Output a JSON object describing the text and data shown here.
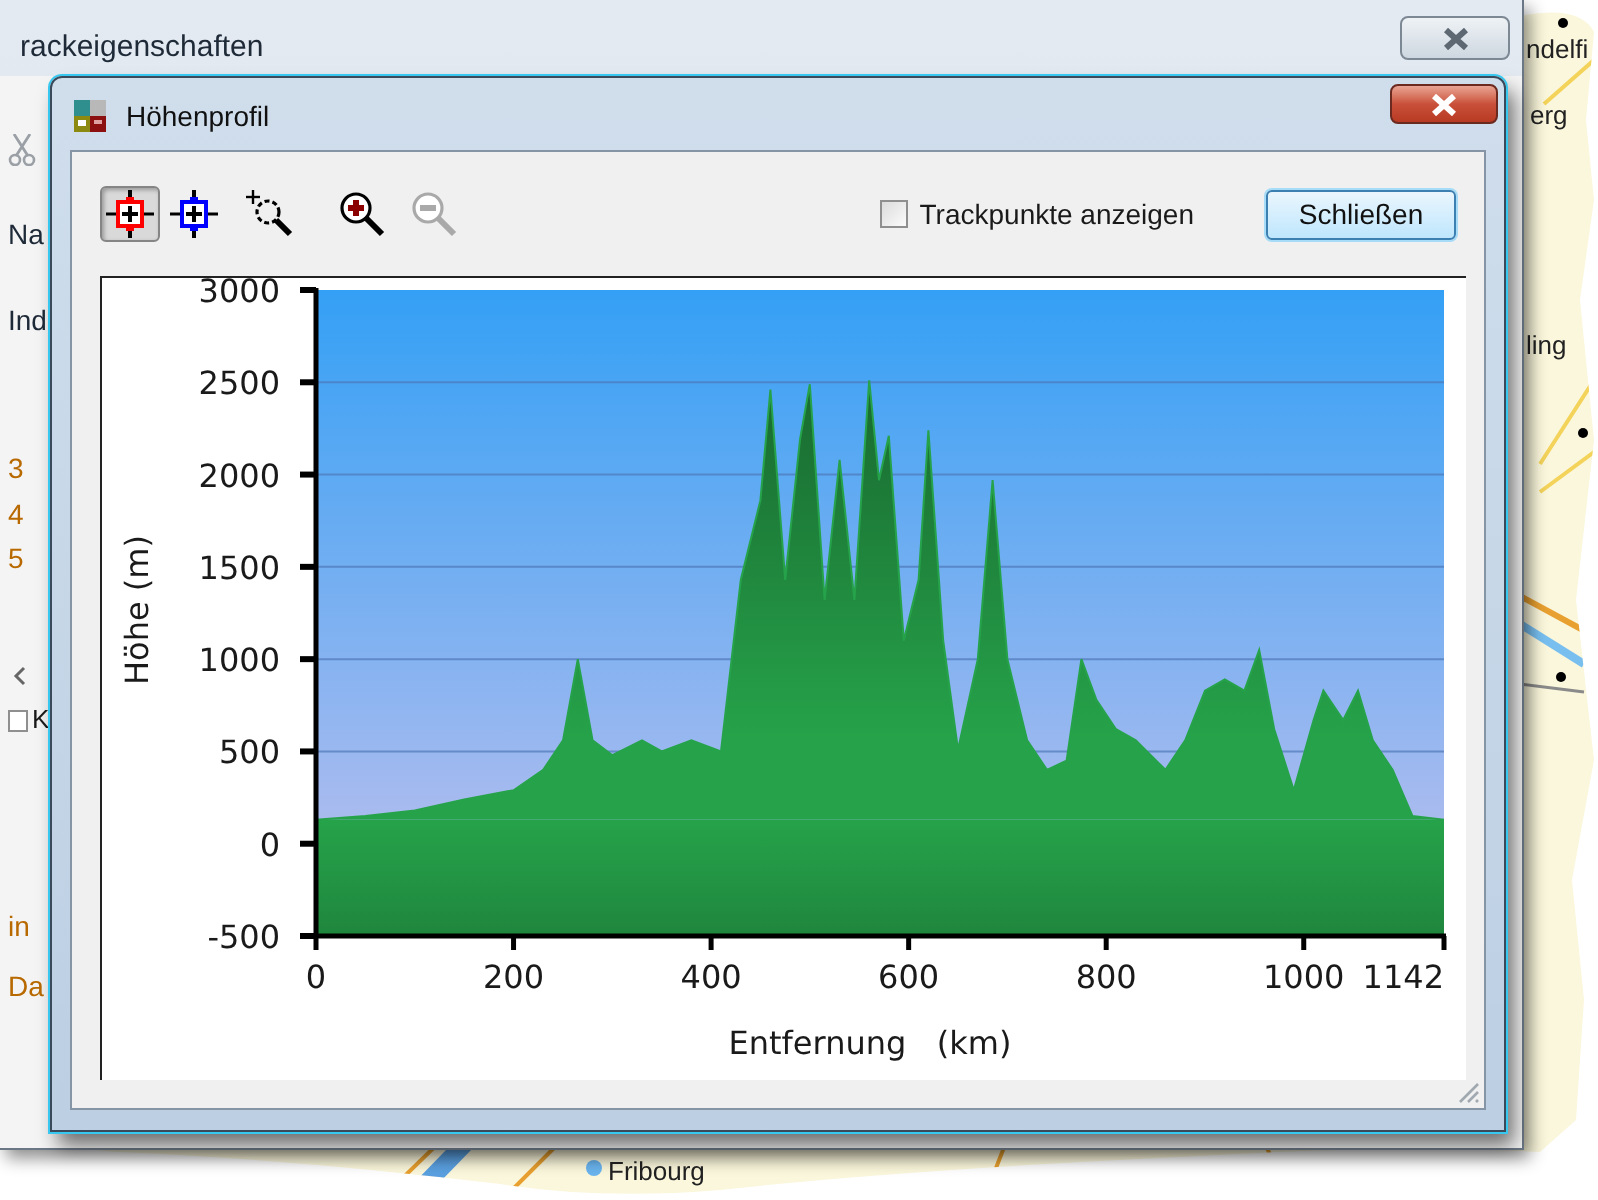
{
  "desktop": {
    "map_labels": [
      "ndelfi",
      "erg",
      "ling",
      "Fribourg"
    ]
  },
  "back_window": {
    "title": "rackeigenschaften",
    "items": [
      {
        "kind": "text",
        "text": "Na"
      },
      {
        "kind": "text",
        "text": "Ind"
      },
      {
        "kind": "text",
        "text": "3"
      },
      {
        "kind": "text",
        "text": "4"
      },
      {
        "kind": "text",
        "text": "5"
      },
      {
        "kind": "checkbox",
        "text": "K",
        "checked": false
      },
      {
        "kind": "text",
        "text": "in"
      },
      {
        "kind": "text",
        "text": "Da"
      }
    ]
  },
  "window": {
    "title": "Höhenprofil",
    "tools": [
      {
        "selected": true,
        "disabled": false
      },
      {
        "selected": false,
        "disabled": false
      },
      {
        "selected": false,
        "disabled": false
      },
      {
        "selected": false,
        "disabled": false
      },
      {
        "selected": false,
        "disabled": true
      }
    ],
    "checkbox": {
      "label": "Trackpunkte anzeigen",
      "checked": false
    },
    "button": "Schließen",
    "chart_data": {
      "type": "area",
      "xlabel": "Entfernung   (km)",
      "ylabel": "Höhe (m)",
      "x": [
        0,
        50,
        100,
        150,
        200,
        230,
        250,
        265,
        280,
        300,
        330,
        350,
        380,
        410,
        430,
        450,
        460,
        475,
        490,
        500,
        515,
        530,
        545,
        560,
        570,
        580,
        595,
        610,
        620,
        635,
        650,
        670,
        685,
        700,
        720,
        740,
        760,
        775,
        790,
        810,
        830,
        860,
        880,
        900,
        920,
        940,
        955,
        970,
        990,
        1010,
        1020,
        1040,
        1055,
        1070,
        1090,
        1110,
        1142
      ],
      "series": [
        {
          "color": "#26a34a",
          "values": [
            130,
            150,
            180,
            240,
            290,
            400,
            560,
            1000,
            560,
            480,
            560,
            500,
            560,
            500,
            1430,
            1860,
            2460,
            1430,
            2190,
            2490,
            1320,
            2080,
            1320,
            2510,
            1970,
            2210,
            1100,
            1430,
            2240,
            1100,
            510,
            1000,
            1970,
            1000,
            560,
            400,
            450,
            1000,
            780,
            620,
            560,
            400,
            560,
            830,
            890,
            830,
            1050,
            620,
            290,
            670,
            830,
            670,
            830,
            560,
            400,
            150,
            130
          ]
        }
      ],
      "xlim": [
        0,
        1142
      ],
      "ylim": [
        -500,
        3000
      ],
      "xticks": [
        0,
        200,
        400,
        600,
        800,
        1000,
        1142
      ],
      "yticks": [
        -500,
        0,
        500,
        1000,
        1500,
        2000,
        2500,
        3000
      ],
      "grid": true
    }
  }
}
